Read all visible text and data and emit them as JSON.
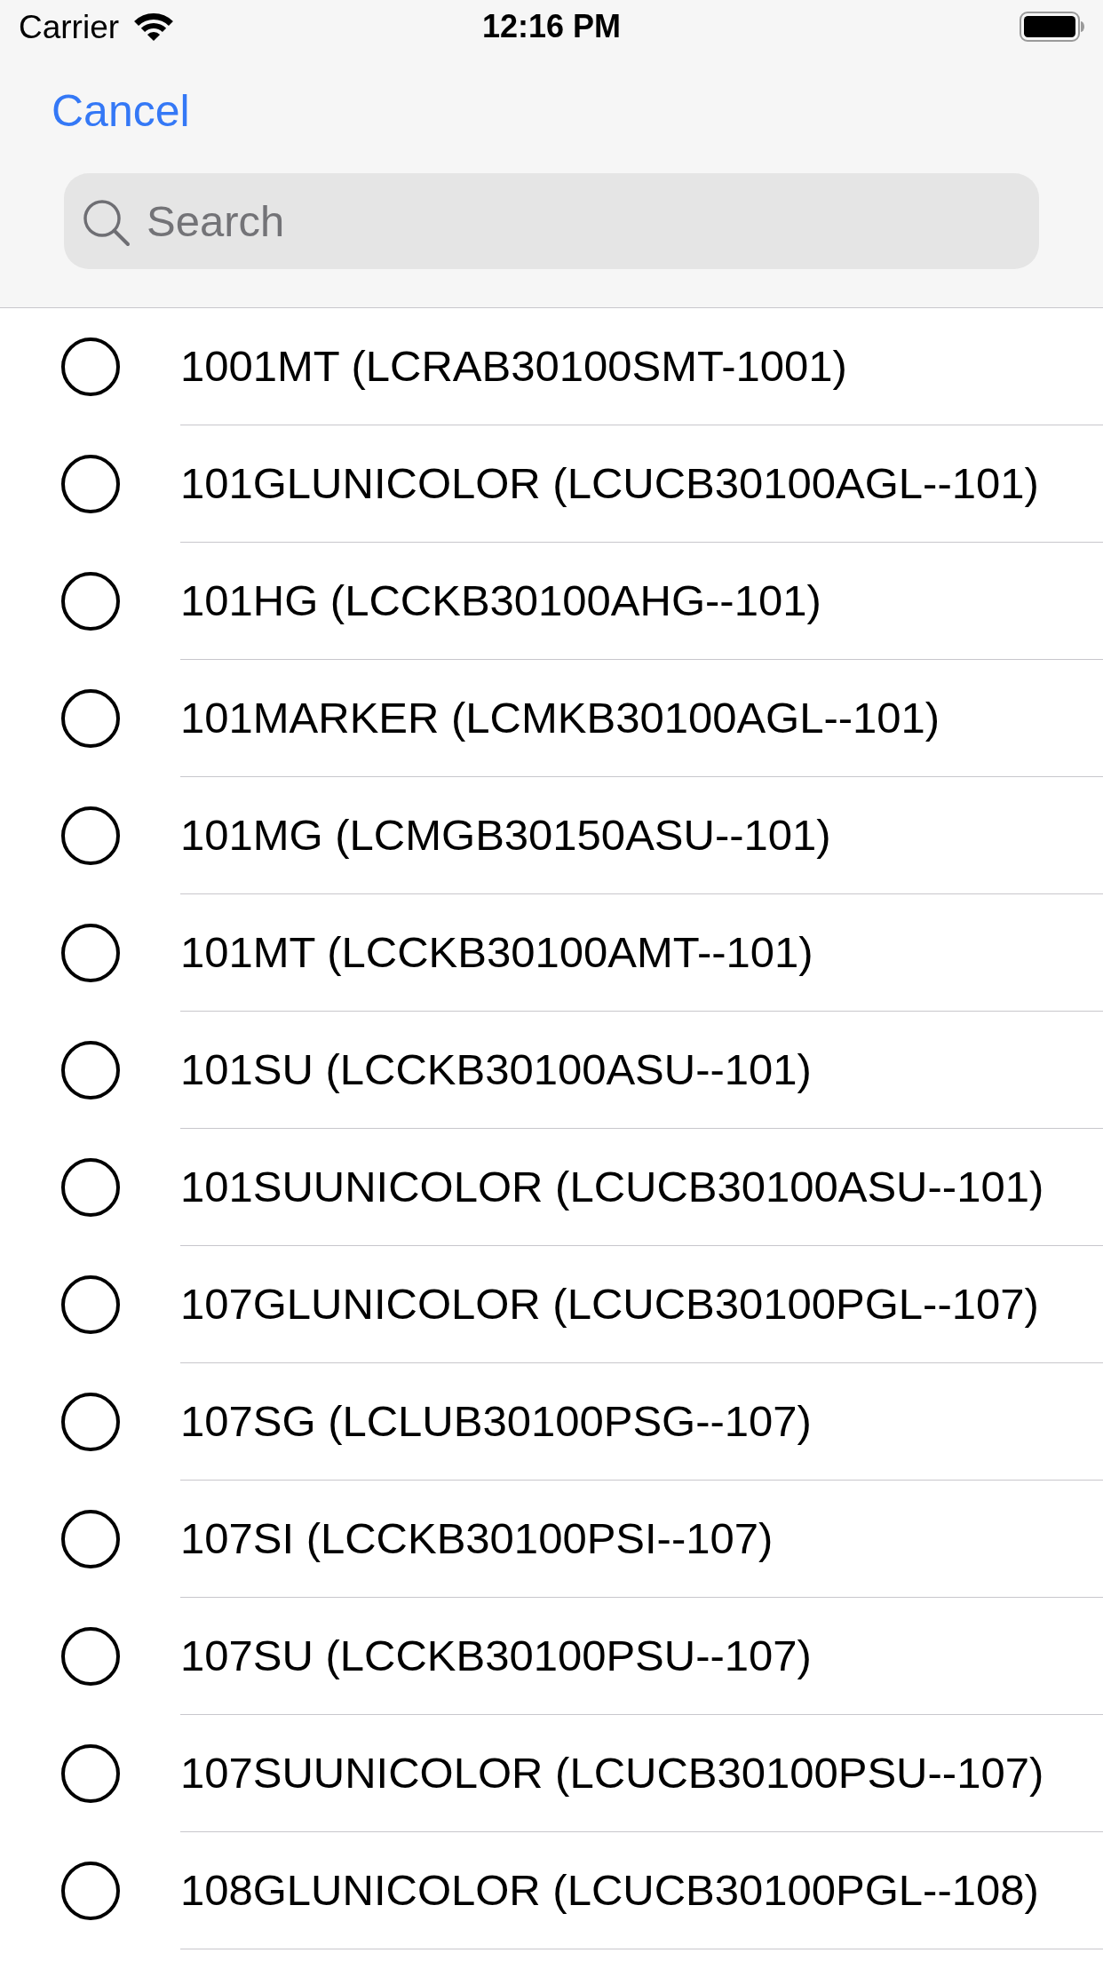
{
  "status_bar": {
    "carrier": "Carrier",
    "time": "12:16 PM"
  },
  "nav": {
    "cancel": "Cancel"
  },
  "search": {
    "placeholder": "Search"
  },
  "items": [
    {
      "label": "1001MT (LCRAB30100SMT-1001)",
      "selected": false
    },
    {
      "label": "101GLUNICOLOR (LCUCB30100AGL--101)",
      "selected": false
    },
    {
      "label": "101HG (LCCKB30100AHG--101)",
      "selected": false
    },
    {
      "label": "101MARKER (LCMKB30100AGL--101)",
      "selected": false
    },
    {
      "label": "101MG (LCMGB30150ASU--101)",
      "selected": false
    },
    {
      "label": "101MT (LCCKB30100AMT--101)",
      "selected": false
    },
    {
      "label": "101SU (LCCKB30100ASU--101)",
      "selected": false
    },
    {
      "label": "101SUUNICOLOR (LCUCB30100ASU--101)",
      "selected": false
    },
    {
      "label": "107GLUNICOLOR (LCUCB30100PGL--107)",
      "selected": false
    },
    {
      "label": "107SG (LCLUB30100PSG--107)",
      "selected": false
    },
    {
      "label": "107SI (LCCKB30100PSI--107)",
      "selected": false
    },
    {
      "label": "107SU (LCCKB30100PSU--107)",
      "selected": false
    },
    {
      "label": "107SUUNICOLOR (LCUCB30100PSU--107)",
      "selected": false
    },
    {
      "label": "108GLUNICOLOR (LCUCB30100PGL--108)",
      "selected": false
    }
  ]
}
